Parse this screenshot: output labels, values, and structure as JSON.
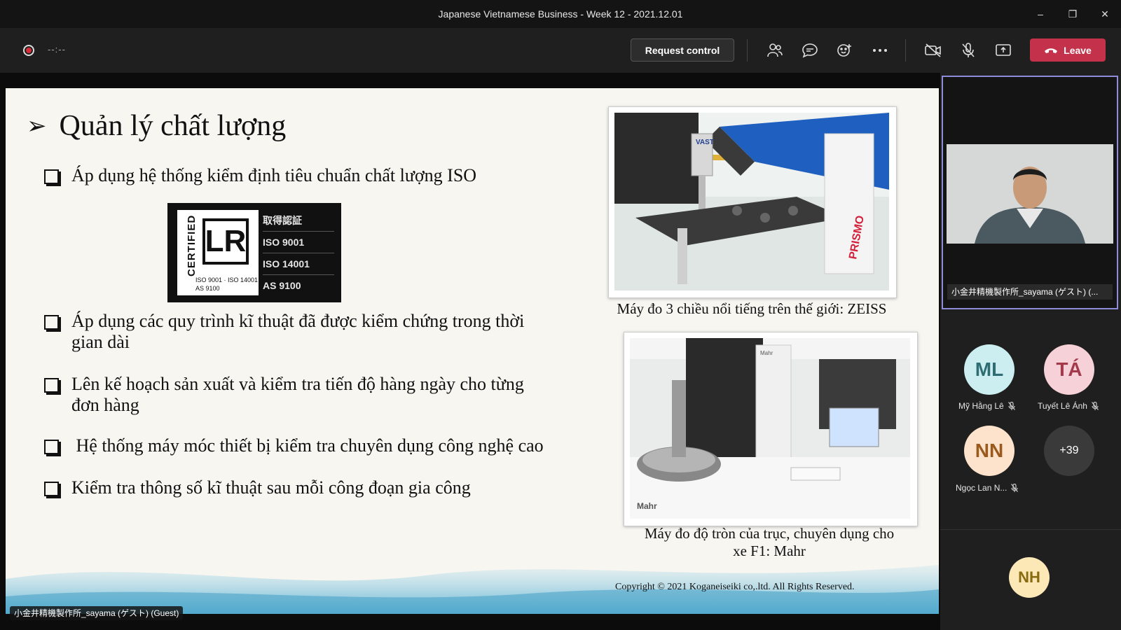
{
  "window": {
    "title": "Japanese Vietnamese Business - Week 12 - 2021.12.01",
    "minimize": "–",
    "restore": "❐",
    "close": "✕"
  },
  "toolbar": {
    "timer": "--:--",
    "request_control": "Request control",
    "leave": "Leave",
    "leave_color": "#c4314b"
  },
  "slide": {
    "title": "Quản lý chất lượng",
    "bullets": [
      "Áp dụng hệ thống kiểm định tiêu chuẩn chất lượng ISO",
      "Áp dụng các quy trình kĩ thuật đã được kiểm chứng trong thời gian dài",
      "Lên kế hoạch sản xuất và kiểm tra tiến độ hàng ngày cho từng đơn hàng",
      " Hệ thống máy móc thiết bị kiểm tra chuyên dụng công nghệ cao",
      "Kiểm tra thông số kĩ thuật sau mỗi công đoạn gia công"
    ],
    "cert": {
      "certified": "CERTIFIED",
      "logo": "LR",
      "iso_line1": "ISO 9001 · ISO 14001",
      "iso_line2": "AS 9100",
      "header": "取得認証",
      "items": [
        "ISO 9001",
        "ISO 14001",
        "AS 9100"
      ]
    },
    "photo1_caption": "Máy đo 3 chiều nổi tiếng trên thế giới: ZEISS",
    "photo1_text": "PRISMO",
    "photo1_brand": "VAST",
    "photo2_caption_line1": "Máy đo độ tròn của trục, chuyên dụng cho",
    "photo2_caption_line2": "xe F1: Mahr",
    "photo2_brand": "Mahr",
    "copyright": "Copyright © 2021 Koganeiseiki co,.ltd. All Rights Reserved."
  },
  "presenter_label": "小金井精機製作所_sayama (ゲスト) (Guest)",
  "speaker": {
    "name": "小金井精機製作所_sayama (ゲスト) (..."
  },
  "participants": [
    {
      "initials": "ML",
      "name": "Mỹ Hằng Lê",
      "bg": "#cdeef0",
      "fg": "#2e6d73"
    },
    {
      "initials": "TÁ",
      "name": "Tuyết Lê Ánh",
      "bg": "#f6d2d8",
      "fg": "#a33a4c"
    },
    {
      "initials": "NN",
      "name": "Ngọc Lan N...",
      "bg": "#fde3cc",
      "fg": "#9a5a1e"
    },
    {
      "initials": "+39",
      "name": "",
      "bg": "#3a3a3a",
      "fg": "#ffffff"
    }
  ],
  "bottom_avatar": {
    "initials": "NH",
    "bg": "#fbe8b6",
    "fg": "#8a6a10"
  }
}
